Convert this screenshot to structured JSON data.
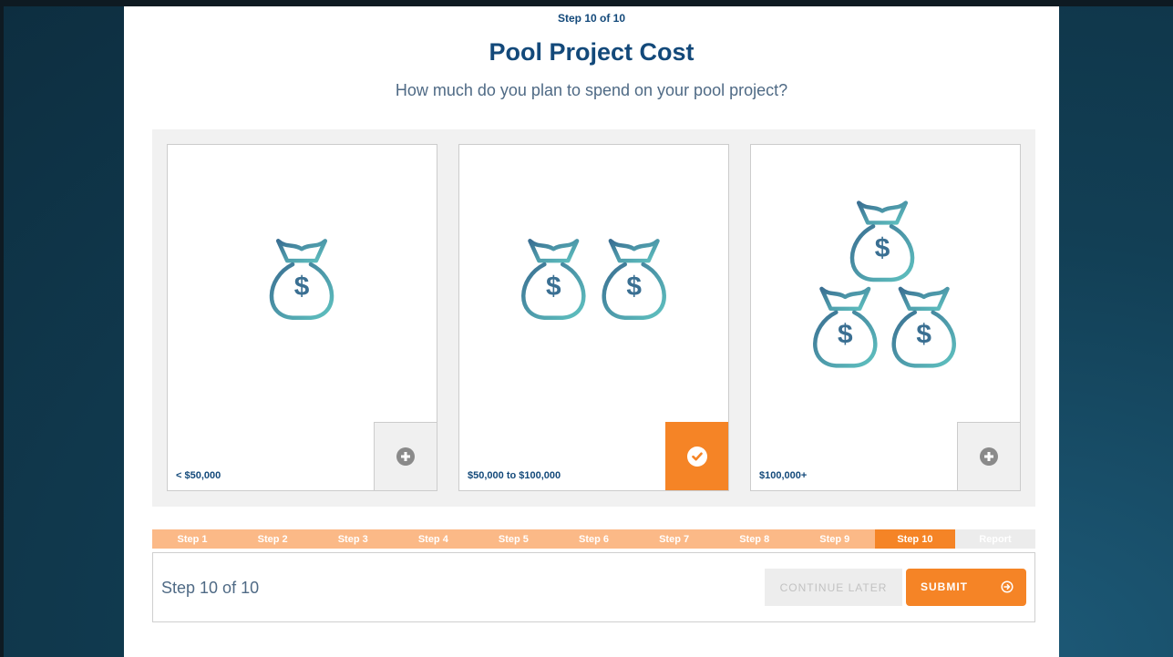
{
  "header": {
    "step_indicator": "Step 10 of 10",
    "title": "Pool Project Cost",
    "subtitle": "How much do you plan to spend on your pool project?"
  },
  "options": [
    {
      "label": "< $50,000",
      "bags": 1,
      "selected": false,
      "icon": "money-bag-icon"
    },
    {
      "label": "$50,000 to $100,000",
      "bags": 2,
      "selected": true,
      "icon": "money-bag-icon"
    },
    {
      "label": "$100,000+",
      "bags": 3,
      "selected": false,
      "icon": "money-bag-icon"
    }
  ],
  "progress": {
    "steps": [
      "Step 1",
      "Step 2",
      "Step 3",
      "Step 4",
      "Step 5",
      "Step 6",
      "Step 7",
      "Step 8",
      "Step 9",
      "Step 10"
    ],
    "active_step": 10,
    "report_label": "Report"
  },
  "footer": {
    "status": "Step 10 of 10",
    "continue_later_label": "CONTINUE LATER",
    "submit_label": "SUBMIT"
  },
  "colors": {
    "accent": "#f58426",
    "accent_light": "#fbb987",
    "title": "#13497a",
    "icon_gradient_start": "#3a6f92",
    "icon_gradient_end": "#5fc2c0"
  }
}
